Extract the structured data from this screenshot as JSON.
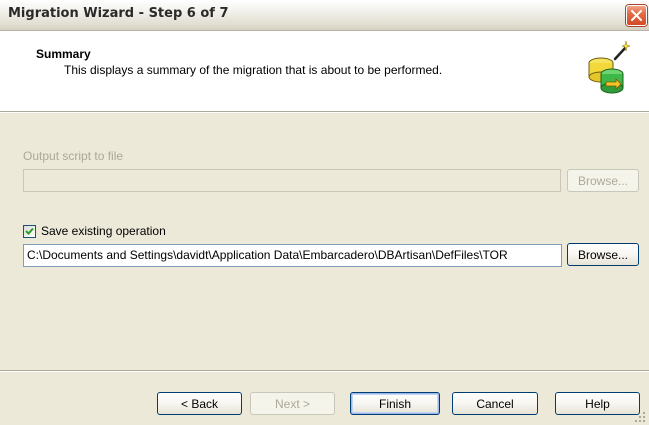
{
  "window": {
    "title": "Migration Wizard - Step 6 of 7",
    "close_icon": "close-icon"
  },
  "header": {
    "title": "Summary",
    "description": "This displays a summary of the migration that is about to be performed.",
    "icon": "database-wizard-icon"
  },
  "output_script": {
    "label": "Output script to file",
    "value": "",
    "browse_label": "Browse...",
    "enabled": false
  },
  "save_operation": {
    "label": "Save existing operation",
    "checked": true,
    "path": "C:\\Documents and Settings\\davidt\\Application Data\\Embarcadero\\DBArtisan\\DefFiles\\TOR",
    "browse_label": "Browse..."
  },
  "footer": {
    "back_label": "< Back",
    "next_label": "Next >",
    "finish_label": "Finish",
    "cancel_label": "Cancel",
    "help_label": "Help"
  },
  "colors": {
    "dialog_bg": "#ece9d8",
    "close_button": "#d24b25",
    "disabled_text": "#aca899",
    "button_border": "#003c74",
    "check_mark": "#21a121"
  }
}
